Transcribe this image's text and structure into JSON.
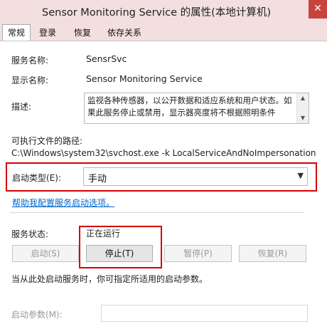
{
  "window": {
    "title": "Sensor Monitoring Service 的属性(本地计算机)"
  },
  "tabs": [
    {
      "label": "常规",
      "active": true
    },
    {
      "label": "登录",
      "active": false
    },
    {
      "label": "恢复",
      "active": false
    },
    {
      "label": "依存关系",
      "active": false
    }
  ],
  "general": {
    "service_name_label": "服务名称:",
    "service_name_value": "SensrSvc",
    "display_name_label": "显示名称:",
    "display_name_value": "Sensor Monitoring Service",
    "description_label": "描述:",
    "description_value": "监视各种传感器，以公开数据和适应系统和用户状态。如果此服务停止或禁用，显示器亮度将不根据照明条件",
    "exe_path_label": "可执行文件的路径:",
    "exe_path_value": "C:\\Windows\\system32\\svchost.exe -k LocalServiceAndNoImpersonation",
    "startup_type_label": "启动类型(E):",
    "startup_type_value": "手动",
    "help_link": "帮助我配置服务启动选项。",
    "status_label": "服务状态:",
    "status_value": "正在运行",
    "buttons": {
      "start": "启动(S)",
      "stop": "停止(T)",
      "pause": "暂停(P)",
      "resume": "恢复(R)"
    },
    "hint": "当从此处启动服务时，你可指定所适用的启动参数。",
    "start_params_label": "启动参数(M):",
    "start_params_value": ""
  },
  "colors": {
    "highlight_border": "#d40000",
    "link": "#0066cc",
    "title_bg": "#f3dfe0"
  },
  "icons": {
    "close": "close-icon",
    "dropdown": "chevron-down-icon"
  }
}
